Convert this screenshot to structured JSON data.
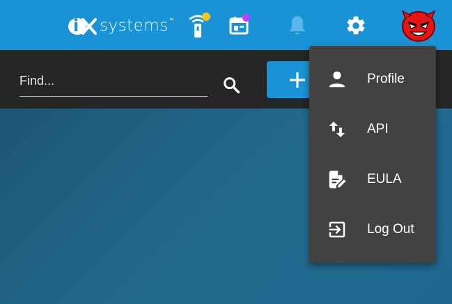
{
  "brand": {
    "logo_mark": "iX",
    "logo_text": "systems",
    "logo_tm": "™"
  },
  "topbar": {
    "icons": [
      "truecommand-remote-icon",
      "jobs-calendar-icon",
      "bell-icon",
      "gear-icon",
      "user-avatar"
    ],
    "colors": {
      "background": "#1a93d6",
      "status_yellow": "#f7c51e",
      "status_purple": "#c040ff"
    }
  },
  "toolbar": {
    "search": {
      "placeholder": "Find...",
      "value": ""
    },
    "add_label": "+"
  },
  "user_menu": {
    "items": [
      {
        "label": "Profile",
        "icon": "person-icon"
      },
      {
        "label": "API",
        "icon": "swap-vertical-icon"
      },
      {
        "label": "EULA",
        "icon": "file-document-edit-icon"
      },
      {
        "label": "Log Out",
        "icon": "exit-to-app-icon"
      }
    ]
  }
}
